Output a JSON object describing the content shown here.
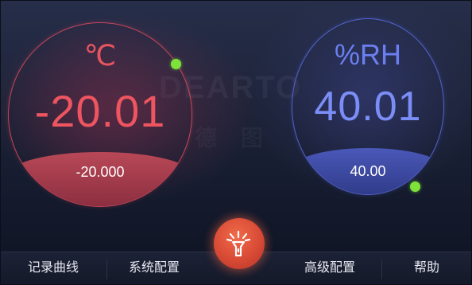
{
  "temperature": {
    "unit": "℃",
    "reading": "-20.01",
    "setpoint": "-20.000",
    "accent_color": "#ee5560"
  },
  "humidity": {
    "unit": "%RH",
    "reading": "40.01",
    "setpoint": "40.00",
    "accent_color": "#7b8ef7"
  },
  "watermark": {
    "latin": "DEARTO",
    "chinese": "德图"
  },
  "indicator_color": "#7ee23a",
  "nav": {
    "record_curve": "记录曲线",
    "system_config": "系统配置",
    "advanced_config": "高级配置",
    "help": "帮助",
    "center_icon": "flashlight-icon"
  }
}
